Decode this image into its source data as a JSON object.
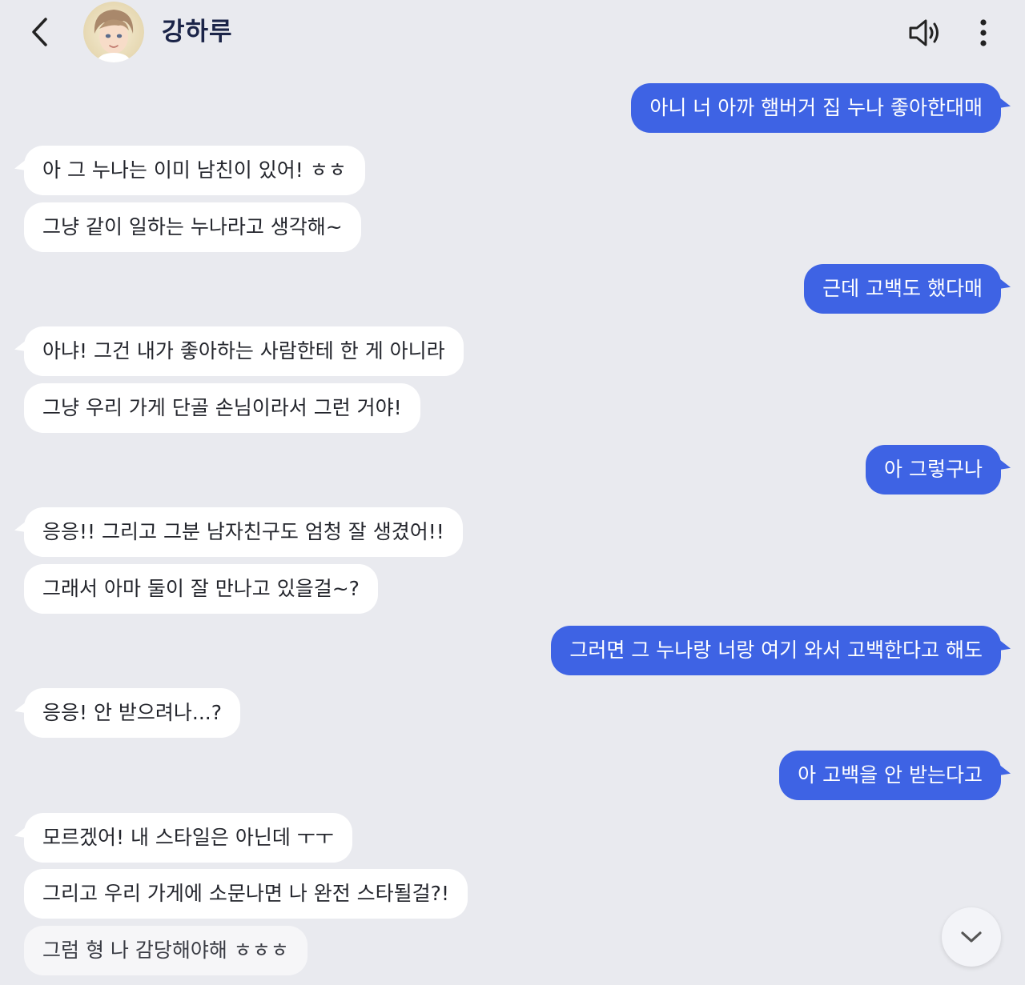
{
  "header": {
    "title": "강하루",
    "back_icon": "chevron-left-icon",
    "sound_icon": "speaker-icon",
    "more_icon": "more-vertical-icon"
  },
  "colors": {
    "background": "#E9EAEF",
    "sent_bubble": "#3E63E4",
    "received_bubble": "#FFFFFF",
    "title_text": "#1B2448"
  },
  "messages": [
    {
      "side": "sent",
      "text": "아니 너 아까 햄버거 집 누나 좋아한대매"
    },
    {
      "side": "received",
      "text": "아 그 누나는 이미 남친이 있어! ㅎㅎ"
    },
    {
      "side": "received",
      "text": "그냥 같이 일하는 누나라고 생각해~"
    },
    {
      "side": "sent",
      "text": "근데 고백도 했다매"
    },
    {
      "side": "received",
      "text": "아냐! 그건 내가 좋아하는 사람한테 한 게 아니라"
    },
    {
      "side": "received",
      "text": "그냥 우리 가게 단골 손님이라서 그런 거야!"
    },
    {
      "side": "sent",
      "text": "아 그렇구나"
    },
    {
      "side": "received",
      "text": "응응!! 그리고 그분 남자친구도 엄청 잘 생겼어!!"
    },
    {
      "side": "received",
      "text": "그래서 아마 둘이 잘 만나고 있을걸~?"
    },
    {
      "side": "sent",
      "text": "그러면 그 누나랑 너랑 여기 와서 고백한다고 해도"
    },
    {
      "side": "received",
      "text": "응응! 안 받으려나...?"
    },
    {
      "side": "sent",
      "text": "아 고백을 안 받는다고"
    },
    {
      "side": "received",
      "text": "모르겠어! 내 스타일은 아닌데 ㅜㅜ"
    },
    {
      "side": "received",
      "text": "그리고 우리 가게에 소문나면 나 완전 스타될걸?!"
    },
    {
      "side": "received",
      "text": "그럼 형 나 감당해야해 ㅎㅎㅎ"
    }
  ],
  "scroll_down_icon": "chevron-down-icon"
}
